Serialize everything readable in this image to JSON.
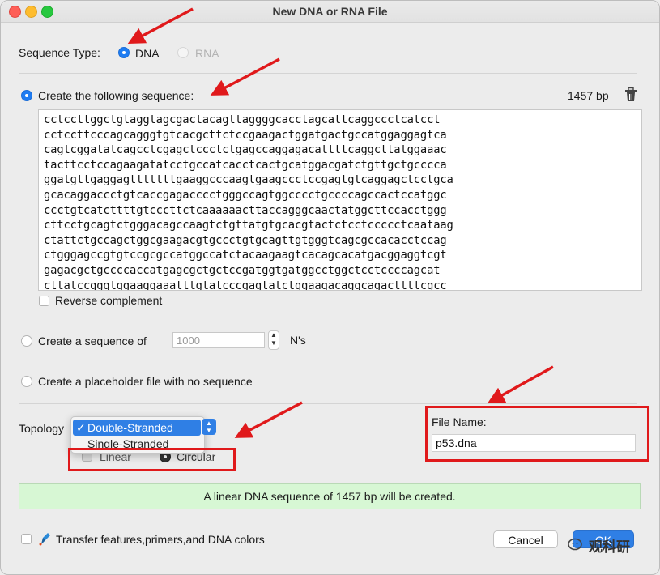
{
  "window": {
    "title": "New DNA or RNA File"
  },
  "sequence_type": {
    "label": "Sequence Type:",
    "options": [
      {
        "label": "DNA",
        "selected": true,
        "enabled": true
      },
      {
        "label": "RNA",
        "selected": false,
        "enabled": false
      }
    ]
  },
  "create_sequence": {
    "label": "Create the following sequence:",
    "length": "1457 bp",
    "delete_icon": "trash-icon",
    "lines": [
      "cctccttggctgtaggtagcgactacagttaggggcacctagcattcaggccctcatcct",
      "cctccttcccagcagggtgtcacgcttctccgaagactggatgactgccatggaggagtca",
      "cagtcggatatcagcctcgagctccctctgagccaggagacattttcaggcttatggaaac",
      "tacttcctccagaagatatcctgccatcacctcactgcatggacgatctgttgctgcccca",
      "ggatgttgaggagtttttttgaaggcccaagtgaagccctccgagtgtcaggagctcctgca",
      "gcacaggaccctgtcaccgagacccctgggccagtggcccctgccccagccactccatggc",
      "ccctgtcatcttttgtcccttctcaaaaaacttaccagggcaactatggcttccacctggg",
      "cttcctgcagtctgggacagccaagtctgttatgtgcacgtactctcctccccctcaataag",
      "ctattctgccagctggcgaagacgtgccctgtgcagttgtgggtcagcgccacacctccag",
      "ctgggagccgtgtccgcgccatggccatctacaagaagtcacagcacatgacggaggtcgt",
      "gagacgctgccccaccatgagcgctgctccgatggtgatggcctggctcctccccagcat",
      "cttatccgggtggaaggaaatttgtatcccgagtatctggaagacaggcagacttttcgcc"
    ],
    "reverse_complement_label": "Reverse complement"
  },
  "create_ns": {
    "label_before": "Create a sequence of",
    "placeholder": "1000",
    "label_after": "N's"
  },
  "placeholder_option": {
    "label": "Create a placeholder file with no sequence"
  },
  "topology": {
    "label": "Topology",
    "dropdown_options": [
      "Double-Stranded",
      "Single-Stranded"
    ],
    "selected": "Double-Stranded",
    "check_mark": "✓",
    "shape_options": [
      "Linear",
      "Circular"
    ]
  },
  "file_name": {
    "label": "File Name:",
    "value": "p53.dna"
  },
  "status_message": "A linear DNA sequence of 1457 bp will be created.",
  "transfer": {
    "label": "Transfer features,primers,and DNA colors",
    "icon": "pen-icon"
  },
  "buttons": {
    "cancel": "Cancel",
    "ok": "OK"
  },
  "watermark": "观科研",
  "colors": {
    "accent": "#2f7fe5",
    "status_bg": "#d7f7d4",
    "annotation_red": "#e0191b"
  }
}
